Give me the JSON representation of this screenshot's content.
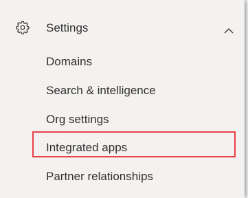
{
  "nav": {
    "section": {
      "icon": "gear-icon",
      "label": "Settings",
      "toggle_icon": "chevron-up-icon",
      "expanded": true
    },
    "items": [
      {
        "label": "Domains"
      },
      {
        "label": "Search & intelligence"
      },
      {
        "label": "Org settings"
      },
      {
        "label": "Integrated apps",
        "highlighted": true
      },
      {
        "label": "Partner relationships"
      }
    ]
  },
  "colors": {
    "panel_background": "#f3f2f1",
    "text": "#323130",
    "highlight_border": "#e8414a"
  }
}
